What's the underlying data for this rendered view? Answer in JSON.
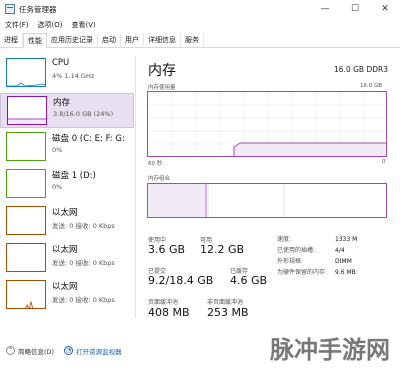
{
  "window": {
    "title": "任务管理器",
    "buttons": [
      "—",
      "☐",
      "✕"
    ]
  },
  "menu": [
    "文件(F)",
    "选项(O)",
    "查看(V)"
  ],
  "tabs": [
    "进程",
    "性能",
    "应用历史记录",
    "启动",
    "用户",
    "详细信息",
    "服务"
  ],
  "active_tab": "性能",
  "sidebar": {
    "items": [
      {
        "name": "CPU",
        "sub": "4% 1.14 GHz",
        "color": "#117dbb"
      },
      {
        "name": "内存",
        "sub": "3.8/16.0 GB (24%)",
        "color": "#8b12ae",
        "selected": true
      },
      {
        "name": "磁盘 0 (C: E: F: G:",
        "sub": "0%",
        "color": "#4da60c"
      },
      {
        "name": "磁盘 1 (D:)",
        "sub": "0%",
        "color": "#4da60c"
      },
      {
        "name": "以太网",
        "sub": "发送: 0 接收: 0 Kbps",
        "color": "#a74f01"
      },
      {
        "name": "以太网",
        "sub": "发送: 0 接收: 0 Kbps",
        "color": "#a74f01"
      },
      {
        "name": "以太网",
        "sub": "发送: 0 接收: 0 Kbps",
        "color": "#a74f01"
      }
    ]
  },
  "main": {
    "title": "内存",
    "spec": "16.0 GB DDR3",
    "usage_label": "内存使用量",
    "usage_max": "16.0 GB",
    "time_label": "60 秒",
    "time_end": "0",
    "composition_label": "内存组合",
    "stats": {
      "in_use_label": "使用中",
      "in_use": "3.6 GB",
      "available_label": "可用",
      "available": "12.2 GB",
      "committed_label": "已提交",
      "committed": "9.2/18.4 GB",
      "cached_label": "已缓存",
      "cached": "4.6 GB",
      "paged_label": "页面缓冲池",
      "paged": "408 MB",
      "nonpaged_label": "非页面缓冲池",
      "nonpaged": "253 MB"
    },
    "right_stats": [
      {
        "label": "速度:",
        "value": "1333 M"
      },
      {
        "label": "已使用的插槽:",
        "value": "4/4"
      },
      {
        "label": "外形规格:",
        "value": "DIMM"
      },
      {
        "label": "为硬件保留的内存:",
        "value": "9.6 MB"
      }
    ]
  },
  "footer": {
    "summary": "简略信息(D)",
    "link": "打开资源监视器"
  },
  "watermark": "脉冲手游网",
  "colors": {
    "memory": "#a24bb8",
    "memory_fill": "#f2eaf6",
    "grid": "#eadff0"
  }
}
